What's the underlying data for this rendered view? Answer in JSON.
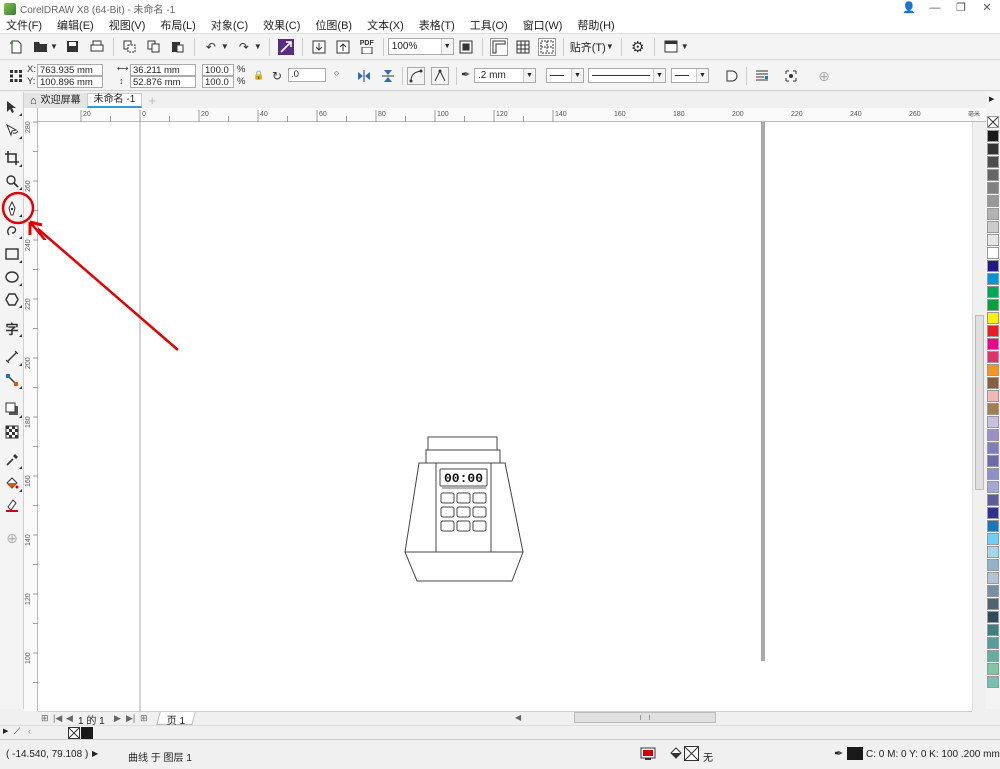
{
  "window": {
    "title": "CorelDRAW X8 (64-Bit) - 未命名 -1"
  },
  "menu": [
    "文件(F)",
    "编辑(E)",
    "视图(V)",
    "布局(L)",
    "对象(C)",
    "效果(C)",
    "位图(B)",
    "文本(X)",
    "表格(T)",
    "工具(O)",
    "窗口(W)",
    "帮助(H)"
  ],
  "toolbar": {
    "zoom": "100%",
    "snap_label": "贴齐(T)",
    "pdf_label": "PDF"
  },
  "propbar": {
    "x_label": "X:",
    "x": "763.935 mm",
    "y_label": "Y:",
    "y": "100.896 mm",
    "w": "36.211 mm",
    "h": "52.876 mm",
    "sx": "100.0",
    "sy": "100.0",
    "pct": "%",
    "rotation": ".0",
    "outline_width": ".2 mm"
  },
  "tabs": {
    "welcome": "欢迎屏幕",
    "doc": "未命名 -1"
  },
  "ruler": {
    "h_ticks": [
      "20",
      "0",
      "20",
      "40",
      "60",
      "80",
      "100",
      "120",
      "140",
      "160",
      "180",
      "200",
      "220",
      "240",
      "260"
    ],
    "h_unit": "毫米",
    "v_ticks": [
      "280",
      "260",
      "240",
      "220",
      "200",
      "180",
      "160",
      "140",
      "120",
      "100"
    ]
  },
  "drawing": {
    "display": "00:00"
  },
  "pagenav": {
    "page_info": "1 的 1",
    "page_tab": "页 1"
  },
  "status": {
    "coords": "( -14.540, 79.108 )",
    "object_info": "曲线 于 图层 1",
    "fill_none": "无",
    "outline_info": "C: 0 M: 0 Y: 0 K: 100  .200 mm"
  },
  "palette_colors": [
    "#1a1a1a",
    "#333333",
    "#4d4d4d",
    "#666666",
    "#808080",
    "#999999",
    "#b3b3b3",
    "#cccccc",
    "#e6e6e6",
    "#ffffff",
    "#1f1a8c",
    "#0096d6",
    "#00a651",
    "#00a03c",
    "#fff200",
    "#ed1c24",
    "#ec008c",
    "#e1306c",
    "#f7941d",
    "#8b5e3c",
    "#f5b7b1",
    "#a67c52",
    "#c9c0e0",
    "#9b8fc9",
    "#7f7fc0",
    "#6b6baa",
    "#8c90c8",
    "#a2a7d5",
    "#5c5c9a",
    "#2e3192",
    "#1b75bc",
    "#6dcff6",
    "#a5d6e8",
    "#8fb3c9",
    "#b0c4d4",
    "#758ea3",
    "#4f6272",
    "#2f4a5a",
    "#3f7f7f",
    "#569e9e",
    "#63b0a0",
    "#7dc8a0",
    "#79c0b0"
  ]
}
